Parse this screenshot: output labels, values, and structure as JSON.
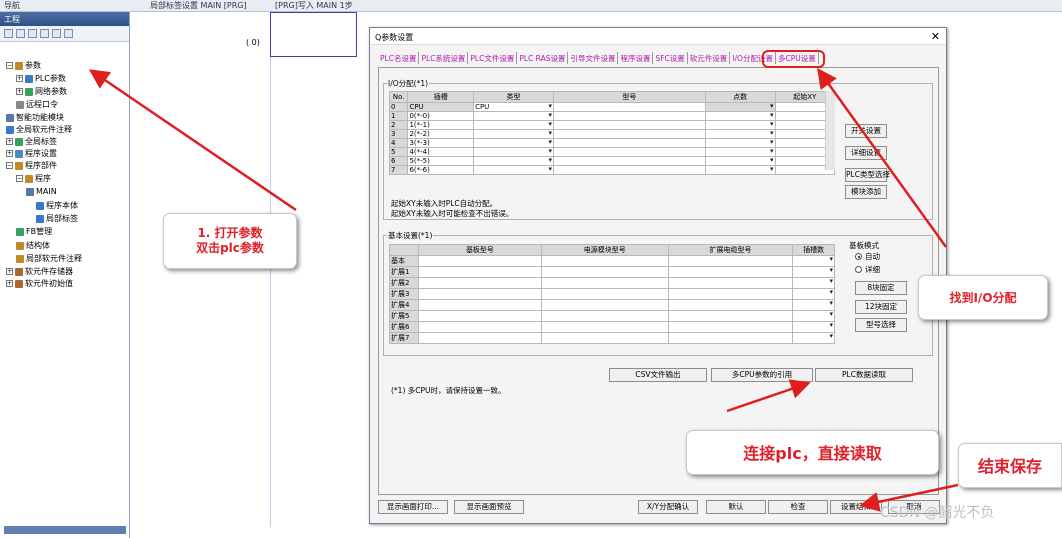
{
  "top_strip": {
    "left_label": "导航",
    "tab1": "局部标签设置 MAIN [PRG]",
    "tab2": "[PRG]写入 MAIN 1步"
  },
  "navigator": {
    "header": "工程",
    "items": [
      {
        "label": "参数",
        "level": 0
      },
      {
        "label": "PLC参数",
        "level": 1
      },
      {
        "label": "网络参数",
        "level": 1
      },
      {
        "label": "远程口令",
        "level": 1
      },
      {
        "label": "智能功能模块",
        "level": 0
      },
      {
        "label": "全局软元件注释",
        "level": 0
      },
      {
        "label": "全局标签",
        "level": 0
      },
      {
        "label": "程序设置",
        "level": 0
      },
      {
        "label": "程序部件",
        "level": 0
      },
      {
        "label": "程序",
        "level": 1
      },
      {
        "label": "MAIN",
        "level": 2
      },
      {
        "label": "程序本体",
        "level": 3
      },
      {
        "label": "局部标签",
        "level": 3
      },
      {
        "label": "FB管理",
        "level": 1
      },
      {
        "label": "结构体",
        "level": 1
      },
      {
        "label": "局部软元件注释",
        "level": 1
      },
      {
        "label": "软元件存储器",
        "level": 0
      },
      {
        "label": "软元件初始值",
        "level": 0
      }
    ]
  },
  "editor": {
    "step_label": "( 0)"
  },
  "dialog": {
    "title": "Q参数设置",
    "close": "✕",
    "tabs": [
      "PLC名设置",
      "PLC系统设置",
      "PLC文件设置",
      "PLC RAS设置",
      "引导文件设置",
      "程序设置",
      "SFC设置",
      "软元件设置",
      "I/O分配设置",
      "多CPU设置"
    ],
    "active_tab": "I/O分配设置",
    "io": {
      "legend": "I/O分配(*1)",
      "headers": [
        "No.",
        "插槽",
        "类型",
        "型号",
        "点数",
        "起始XY"
      ],
      "rows": [
        {
          "no": "0",
          "slot": "CPU",
          "type": "CPU"
        },
        {
          "no": "1",
          "slot": "0(*-0)",
          "type": ""
        },
        {
          "no": "2",
          "slot": "1(*-1)",
          "type": ""
        },
        {
          "no": "3",
          "slot": "2(*-2)",
          "type": ""
        },
        {
          "no": "4",
          "slot": "3(*-3)",
          "type": ""
        },
        {
          "no": "5",
          "slot": "4(*-4)",
          "type": ""
        },
        {
          "no": "6",
          "slot": "5(*-5)",
          "type": ""
        },
        {
          "no": "7",
          "slot": "6(*-6)",
          "type": ""
        }
      ],
      "buttons": [
        "开关设置",
        "详细设置",
        "PLC类型选择",
        "模块添加"
      ],
      "note1": "起始XY未输入时PLC自动分配。",
      "note2": "起始XY未输入时可能检查不出错误。"
    },
    "base": {
      "legend": "基本设置(*1)",
      "headers": [
        "",
        "基板型号",
        "电源模块型号",
        "扩展电缆型号",
        "插槽数"
      ],
      "rows": [
        "基本",
        "扩展1",
        "扩展2",
        "扩展3",
        "扩展4",
        "扩展5",
        "扩展6",
        "扩展7"
      ],
      "mode_label": "基板模式",
      "mode_auto": "自动",
      "mode_detail": "详细",
      "buttons": [
        "8块固定",
        "12块固定",
        "型号选择"
      ]
    },
    "mid_buttons": [
      "CSV文件输出",
      "多CPU参数的引用",
      "PLC数据读取"
    ],
    "multicpu_note": "(*1) 多CPU时，请保持设置一致。",
    "bottom_buttons": [
      "显示画面打印...",
      "显示画面预览",
      "X/Y分配确认",
      "默认",
      "检查",
      "设置结束",
      "取消"
    ]
  },
  "annotations": {
    "step1_line1": "1. 打开参数",
    "step1_line2": "双击plc参数",
    "find_io": "找到I/O分配",
    "connect_read": "连接plc，直接读取",
    "finish_save": "结束保存"
  },
  "watermark": "CSDN @韶光不负",
  "colors": {
    "tab_text": "#b01ab0",
    "annotation_red": "#e0202a",
    "arrow_red": "#e01e1e"
  }
}
